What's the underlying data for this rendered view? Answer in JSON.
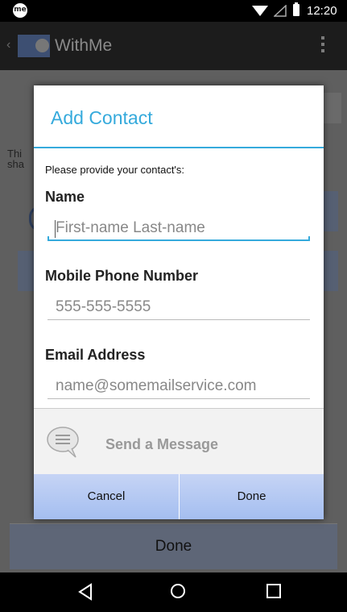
{
  "status_bar": {
    "app_badge": "me",
    "time": "12:20"
  },
  "action_bar": {
    "title": "WithMe"
  },
  "background": {
    "partial_text_line1": "Thi",
    "partial_text_line2": "sha",
    "done_label": "Done"
  },
  "dialog": {
    "title": "Add Contact",
    "subtitle": "Please provide your contact's:",
    "fields": [
      {
        "label": "Name",
        "placeholder": "First-name Last-name"
      },
      {
        "label": "Mobile Phone Number",
        "placeholder": "555-555-5555"
      },
      {
        "label": "Email Address",
        "placeholder": "name@somemailservice.com"
      }
    ],
    "send_message_label": "Send a Message",
    "cancel_label": "Cancel",
    "done_label": "Done"
  },
  "colors": {
    "accent": "#35aadc",
    "button_gradient_top": "#c6d4f5",
    "button_gradient_bottom": "#a4bef0"
  }
}
